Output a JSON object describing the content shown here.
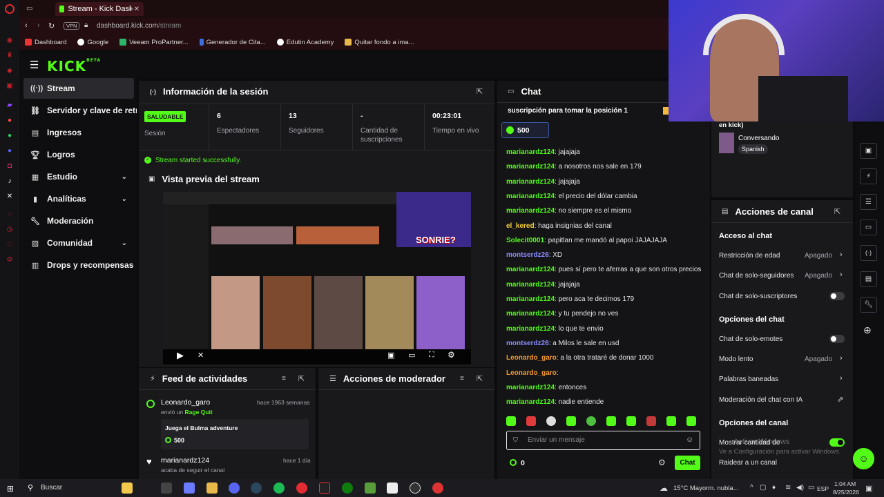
{
  "browser": {
    "tab_title": "Stream - Kick Dashboard",
    "url_host": "dashboard.kick.com",
    "url_path": "/stream",
    "vpn_label": "VPN",
    "bookmarks": [
      "Dashboard",
      "Google",
      "Veeam ProPartner...",
      "Generador de Cita...",
      "Edutin Academy",
      "Quitar fondo a ima..."
    ]
  },
  "logo": {
    "text": "KICK",
    "badge": "BETA"
  },
  "nav": [
    {
      "label": "Stream",
      "icon": "broadcast-icon"
    },
    {
      "label": "Servidor y clave de retransmisión",
      "icon": "link-icon"
    },
    {
      "label": "Ingresos",
      "icon": "wallet-icon"
    },
    {
      "label": "Logros",
      "icon": "trophy-icon"
    },
    {
      "label": "Estudio",
      "icon": "studio-icon"
    },
    {
      "label": "Analíticas",
      "icon": "chart-icon"
    },
    {
      "label": "Moderación",
      "icon": "wrench-icon"
    },
    {
      "label": "Comunidad",
      "icon": "community-icon"
    },
    {
      "label": "Drops y recompensas",
      "icon": "gift-icon"
    }
  ],
  "session": {
    "title": "Información de la sesión",
    "status_badge": "SALUDABLE",
    "status_label": "Sesión",
    "stats": [
      {
        "value": "6",
        "label": "Espectadores"
      },
      {
        "value": "13",
        "label": "Seguidores"
      },
      {
        "value": "-",
        "label": "Cantidad de suscripciones"
      },
      {
        "value": "00:23:01",
        "label": "Tiempo en vivo"
      }
    ],
    "success_msg": "Stream started successfully."
  },
  "preview": {
    "title": "Vista previa del stream",
    "overlay_text": "SONRIE?"
  },
  "activity": {
    "title": "Feed de actividades",
    "items": [
      {
        "user": "Leonardo_garo",
        "time": "hace 1963 semanas",
        "action_prefix": "envió un",
        "action_item": "Rage Quit",
        "message": "Juega el Bulma adventure",
        "amount": "500"
      },
      {
        "user": "marianardz124",
        "time": "hace 1 día",
        "action_prefix": "acaba de seguir el canal"
      }
    ]
  },
  "mod_actions": {
    "title": "Acciones de moderador"
  },
  "chat": {
    "title": "Chat",
    "pinned": "suscripción para tomar la posición 1",
    "pinned_amount": "500",
    "messages": [
      {
        "user": "marianardz124",
        "text": "jajajaja",
        "color": "#53fc18"
      },
      {
        "user": "marianardz124",
        "text": "a nosotros nos sale en 179",
        "color": "#53fc18"
      },
      {
        "user": "marianardz124",
        "text": "jajajaja",
        "color": "#53fc18"
      },
      {
        "user": "marianardz124",
        "text": "el precio del dólar cambia",
        "color": "#53fc18"
      },
      {
        "user": "marianardz124",
        "text": "no siempre es el mismo",
        "color": "#53fc18"
      },
      {
        "user": "el_kered",
        "text": "haga insignias del canal",
        "color": "#f6d43a"
      },
      {
        "user": "Solecit0001",
        "text": "papitlan me mandó al papoi JAJAJAJA",
        "color": "#53fc18"
      },
      {
        "user": "montserdz26",
        "text": "XD",
        "color": "#8b8cff"
      },
      {
        "user": "marianardz124",
        "text": "pues sí pero te aferras a que son otros precios",
        "color": "#53fc18"
      },
      {
        "user": "marianardz124",
        "text": "jajajaja",
        "color": "#53fc18"
      },
      {
        "user": "marianardz124",
        "text": "pero aca te decimos 179",
        "color": "#53fc18"
      },
      {
        "user": "marianardz124",
        "text": "y tu pendejo no ves",
        "color": "#53fc18"
      },
      {
        "user": "marianardz124",
        "text": "lo que te envio",
        "color": "#53fc18"
      },
      {
        "user": "montserdz26",
        "text": "a Milos le sale en usd",
        "color": "#8b8cff"
      },
      {
        "user": "Leonardo_garo",
        "text": "a la otra trataré de donar 1000",
        "color": "#f59b2f"
      },
      {
        "user": "Leonardo_garo",
        "text": "",
        "color": "#f59b2f"
      },
      {
        "user": "marianardz124",
        "text": "entonces",
        "color": "#53fc18"
      },
      {
        "user": "marianardz124",
        "text": "nadie entiende",
        "color": "#53fc18"
      }
    ],
    "input_placeholder": "Enviar un mensaje",
    "points": "0",
    "send_label": "Chat"
  },
  "webcam_side": {
    "category_suffix": "en kick)",
    "tag_title": "Conversando",
    "language": "Spanish"
  },
  "channel_actions": {
    "title": "Acciones de canal",
    "chat_access_title": "Acceso al chat",
    "age_restriction": {
      "label": "Restricción de edad",
      "value": "Apagado"
    },
    "followers_only": {
      "label": "Chat de solo-seguidores",
      "value": "Apagado"
    },
    "subs_only": {
      "label": "Chat de solo-suscriptores"
    },
    "chat_options_title": "Opciones del chat",
    "emotes_only": {
      "label": "Chat de solo-emotes"
    },
    "slow_mode": {
      "label": "Modo lento",
      "value": "Apagado"
    },
    "banned_words": {
      "label": "Palabras baneadas"
    },
    "ai_moderation": {
      "label": "Moderación del chat con IA"
    },
    "channel_options_title": "Opciones del canal",
    "show_count": {
      "label": "Mostrar cantidad de"
    },
    "raid": {
      "label": "Raidear a un canal"
    }
  },
  "windows_watermark": {
    "line1": "Activar Windows",
    "line2": "Ve a Configuración para activar Windows."
  },
  "taskbar": {
    "search_placeholder": "Buscar",
    "weather": "15°C  Mayorm. nubla...",
    "lang": "ESP",
    "time": "1:04 AM",
    "date": "8/25/2026"
  },
  "colors": {
    "accent": "#53fc18",
    "panel": "#19191c",
    "bg": "#0e0e10"
  }
}
